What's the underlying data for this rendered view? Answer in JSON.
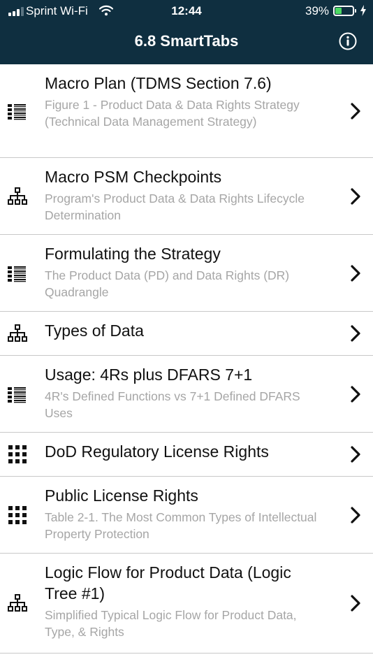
{
  "status_bar": {
    "carrier": "Sprint Wi-Fi",
    "time": "12:44",
    "battery_percent": "39%",
    "battery_level": 0.39,
    "battery_fill_color": "#4cd964",
    "signal_bars_active": 3,
    "signal_bars_total": 4
  },
  "header": {
    "title": "6.8 SmartTabs",
    "background_color": "#0f2f40",
    "info_icon": "info-circle-icon"
  },
  "list": {
    "items": [
      {
        "title": "Macro Plan (TDMS Section 7.6)",
        "subtitle": "Figure 1 - Product Data & Data Rights Strategy (Technical Data Management Strategy)",
        "icon": "list-icon"
      },
      {
        "title": "Macro PSM Checkpoints",
        "subtitle": "Program's Product Data & Data Rights Lifecycle Determination",
        "icon": "hierarchy-icon"
      },
      {
        "title": "Formulating the Strategy",
        "subtitle": "The Product Data (PD) and Data Rights (DR) Quadrangle",
        "icon": "list-icon"
      },
      {
        "title": "Types of Data",
        "subtitle": "",
        "icon": "hierarchy-icon"
      },
      {
        "title": "Usage: 4Rs plus DFARS 7+1",
        "subtitle": "4R's Defined Functions vs 7+1 Defined DFARS Uses",
        "icon": "list-icon"
      },
      {
        "title": "DoD Regulatory License Rights",
        "subtitle": "",
        "icon": "grid-icon"
      },
      {
        "title": "Public License Rights",
        "subtitle": "Table 2-1. The Most Common Types of Intellectual Property Protection",
        "icon": "grid-icon"
      },
      {
        "title": "Logic Flow for Product Data (Logic Tree #1)",
        "subtitle": "Simplified Typical Logic Flow for Product Data, Type, & Rights",
        "icon": "hierarchy-icon"
      }
    ]
  }
}
